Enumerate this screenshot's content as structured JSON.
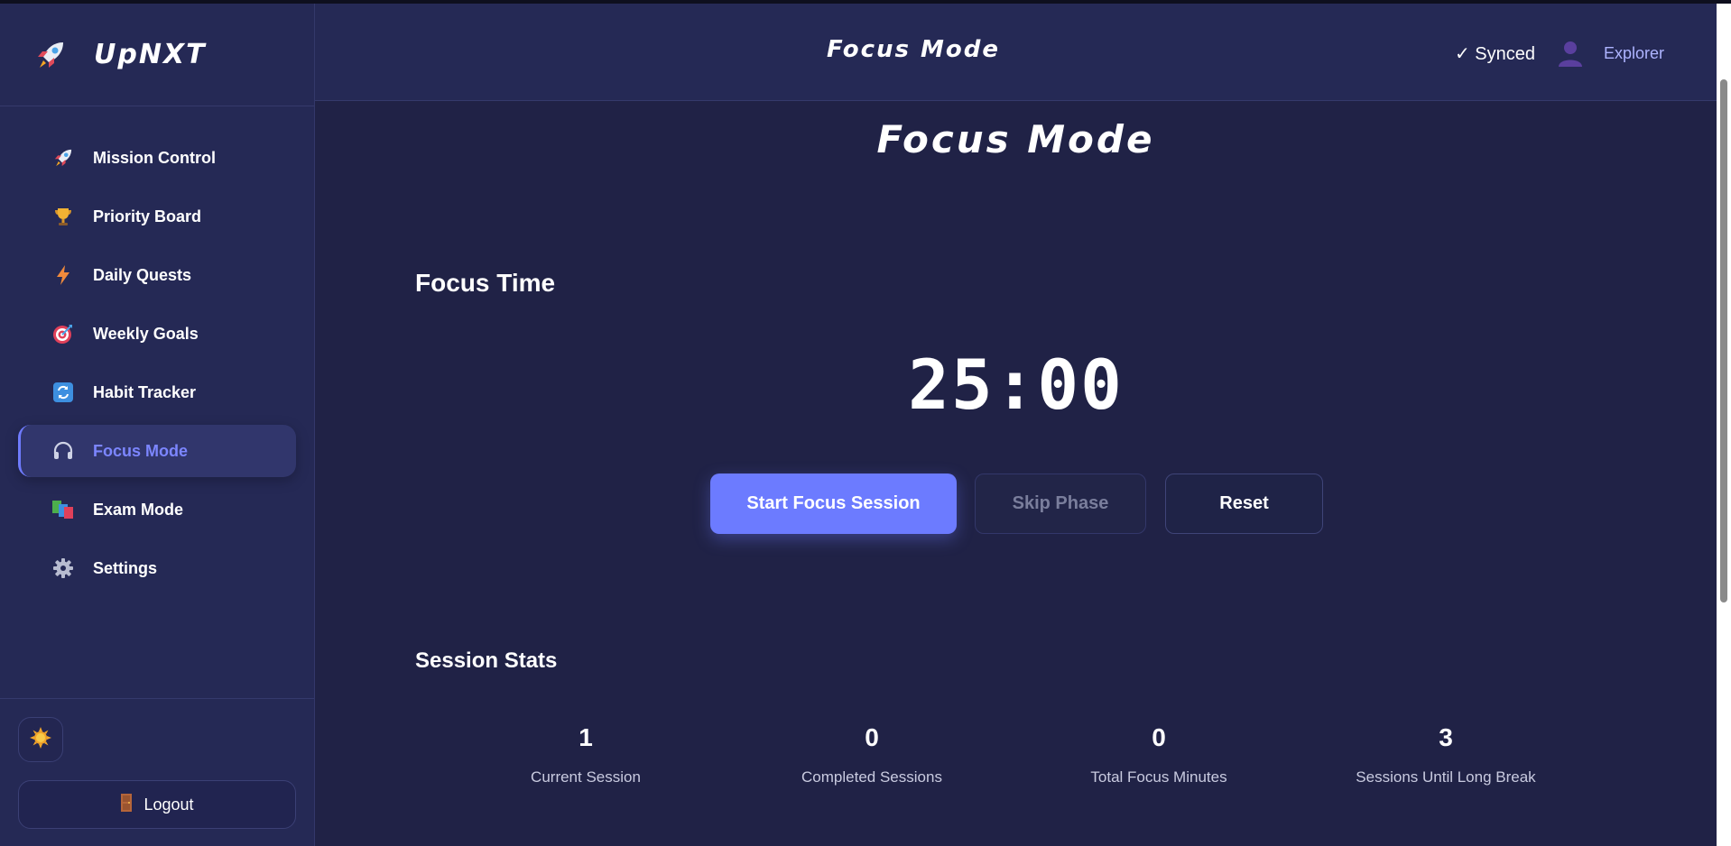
{
  "app": {
    "name": "UpNXT"
  },
  "sidebar": {
    "items": [
      {
        "label": "Mission Control",
        "icon": "rocket-icon",
        "active": false
      },
      {
        "label": "Priority Board",
        "icon": "trophy-icon",
        "active": false
      },
      {
        "label": "Daily Quests",
        "icon": "lightning-icon",
        "active": false
      },
      {
        "label": "Weekly Goals",
        "icon": "target-icon",
        "active": false
      },
      {
        "label": "Habit Tracker",
        "icon": "repeat-icon",
        "active": false
      },
      {
        "label": "Focus Mode",
        "icon": "headphones-icon",
        "active": true
      },
      {
        "label": "Exam Mode",
        "icon": "books-icon",
        "active": false
      },
      {
        "label": "Settings",
        "icon": "gear-icon",
        "active": false
      }
    ],
    "theme_toggle_icon": "sun-icon",
    "logout_label": "Logout",
    "logout_icon": "door-icon"
  },
  "header": {
    "title": "Focus Mode",
    "sync_status": "✓ Synced",
    "user_name": "Explorer",
    "avatar_icon": "user-icon"
  },
  "main": {
    "page_title": "Focus Mode",
    "phase_title": "Focus Time",
    "timer": "25:00",
    "buttons": {
      "start": "Start Focus Session",
      "skip": "Skip Phase",
      "reset": "Reset"
    },
    "stats_title": "Session Stats",
    "stats": [
      {
        "value": "1",
        "label": "Current Session"
      },
      {
        "value": "0",
        "label": "Completed Sessions"
      },
      {
        "value": "0",
        "label": "Total Focus Minutes"
      },
      {
        "value": "3",
        "label": "Sessions Until Long Break"
      }
    ]
  },
  "colors": {
    "background": "#202246",
    "sidebar": "#252955",
    "accent": "#6c7bff",
    "active_text": "#7c86ff"
  }
}
